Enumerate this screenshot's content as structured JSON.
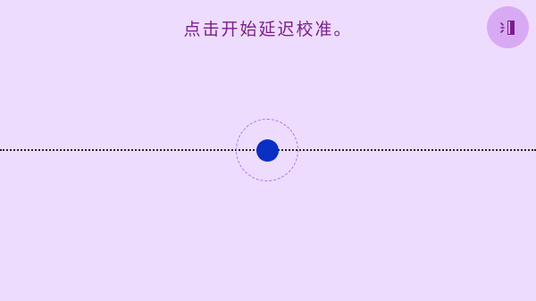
{
  "calibration": {
    "instruction": "点击开始延迟校准。"
  },
  "exit_button": {
    "icon": "exit-door-icon",
    "accent": "#D9AAF4",
    "icon_color": "#7A1E8C"
  },
  "track": {
    "line_style": "dotted",
    "line_color": "#2A2130",
    "ring_color": "#A37BE8",
    "dot_color": "#0A2FC3"
  },
  "theme": {
    "background": "#EEDCFE"
  }
}
